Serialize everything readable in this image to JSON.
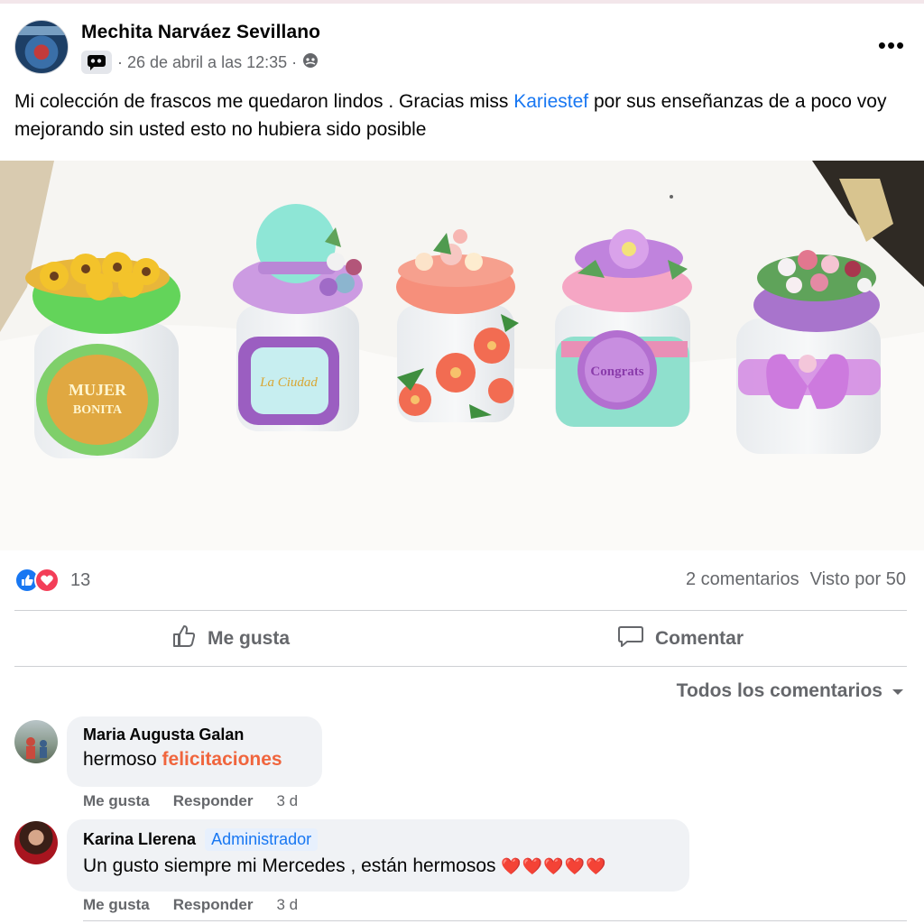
{
  "post": {
    "author": "Mechita Narváez Sevillano",
    "timestamp": "· 26 de abril a las 12:35 ·",
    "caption_before": "Mi colección de frascos me quedaron lindos . Gracias miss ",
    "mention": "Kariestef",
    "caption_after": "  por sus enseñanzas de a poco voy mejorando sin usted esto no hubiera sido posible",
    "more_icon": "more-horizontal-icon",
    "privacy_icon": "group-privacy-icon"
  },
  "photo": {
    "jar_labels": [
      "MUJER",
      "BONITA",
      "Congrats"
    ]
  },
  "stats": {
    "reaction_count": "13",
    "comments": "2 comentarios",
    "views": "Visto por 50"
  },
  "actions": {
    "like": "Me gusta",
    "comment": "Comentar"
  },
  "filter": {
    "label": "Todos los comentarios"
  },
  "comments": [
    {
      "name": "Maria Augusta Galan",
      "text": "hermoso ",
      "emphasis": "felicitaciones",
      "like": "Me gusta",
      "reply": "Responder",
      "time": "3 d"
    },
    {
      "name": "Karina Llerena",
      "badge": "Administrador",
      "text": "Un gusto siempre mi Mercedes , están hermosos ",
      "hearts": "❤️❤️❤️❤️❤️",
      "like": "Me gusta",
      "reply": "Responder",
      "time": "3 d"
    }
  ],
  "colors": {
    "accent": "#1877f2",
    "love": "#f33e58",
    "emphasis": "#f0653d",
    "muted": "#65676b",
    "bubble": "#f0f2f5"
  }
}
